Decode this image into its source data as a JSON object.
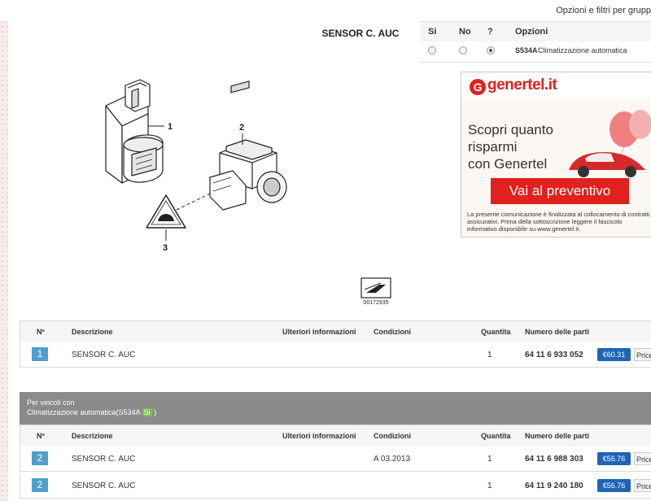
{
  "topbar": {
    "options_filter_label": "Opzioni e filtri per grupp"
  },
  "diagram": {
    "title": "SENSOR C. AUC",
    "callouts": [
      "1",
      "2",
      "3"
    ],
    "image_number": "00172935"
  },
  "options": {
    "headers": {
      "yes": "Si",
      "no": "No",
      "unknown": "?",
      "options": "Opzioni"
    },
    "rows": [
      {
        "selected": "?",
        "code": "S534A",
        "label": "Climatizzazione automatica"
      }
    ]
  },
  "ad": {
    "logo": "genertel.it",
    "logo_letter": "G",
    "headline_lines": [
      "Scopri quanto",
      "risparmi",
      "con Genertel"
    ],
    "cta": "Vai al preventivo",
    "legal": "La presente comunicazione è finalizzata al collocamento di contratti assicurativi. Prima della sottoscrizione leggere il fascicolo informativo disponibile su www.genertel.it.",
    "brand_color": "#e0211d"
  },
  "parts_table_1": {
    "headers": {
      "no": "Nº",
      "description": "Descrizione",
      "more_info": "Ulteriori informazioni",
      "conditions": "Condizioni",
      "quantity": "Quantita",
      "part_number": "Numero delle parti"
    },
    "rows": [
      {
        "no": "1",
        "description": "SENSOR C. AUC",
        "more_info": "",
        "conditions": "",
        "quantity": "1",
        "part_number": "64 11 6 933 052",
        "price": "€60.31",
        "price_link": "Price"
      }
    ]
  },
  "group": {
    "line1": "Per veicoli con",
    "line2_prefix": "Climatizzazione automatica(S534A",
    "line2_badge": "Si",
    "line2_suffix": ")"
  },
  "parts_table_2": {
    "headers": {
      "no": "Nº",
      "description": "Descrizione",
      "more_info": "Ulteriori informazioni",
      "conditions": "Condizioni",
      "quantity": "Quantita",
      "part_number": "Numero delle parti"
    },
    "rows": [
      {
        "no": "2",
        "description": "SENSOR C. AUC",
        "more_info": "",
        "conditions": "A 03.2013",
        "quantity": "1",
        "part_number": "64 11 6 988 303",
        "price": "€56.76",
        "price_link": "Price"
      },
      {
        "no": "2",
        "description": "SENSOR C. AUC",
        "more_info": "",
        "conditions": "",
        "quantity": "1",
        "part_number": "64 11 9 240 180",
        "price": "€56.76",
        "price_link": "Price"
      }
    ]
  },
  "colors": {
    "accent_blue": "#1f65b4",
    "badge_blue": "#4f9fcd",
    "group_gray": "#8a8a8a",
    "yes_green": "#7cbf4a"
  }
}
